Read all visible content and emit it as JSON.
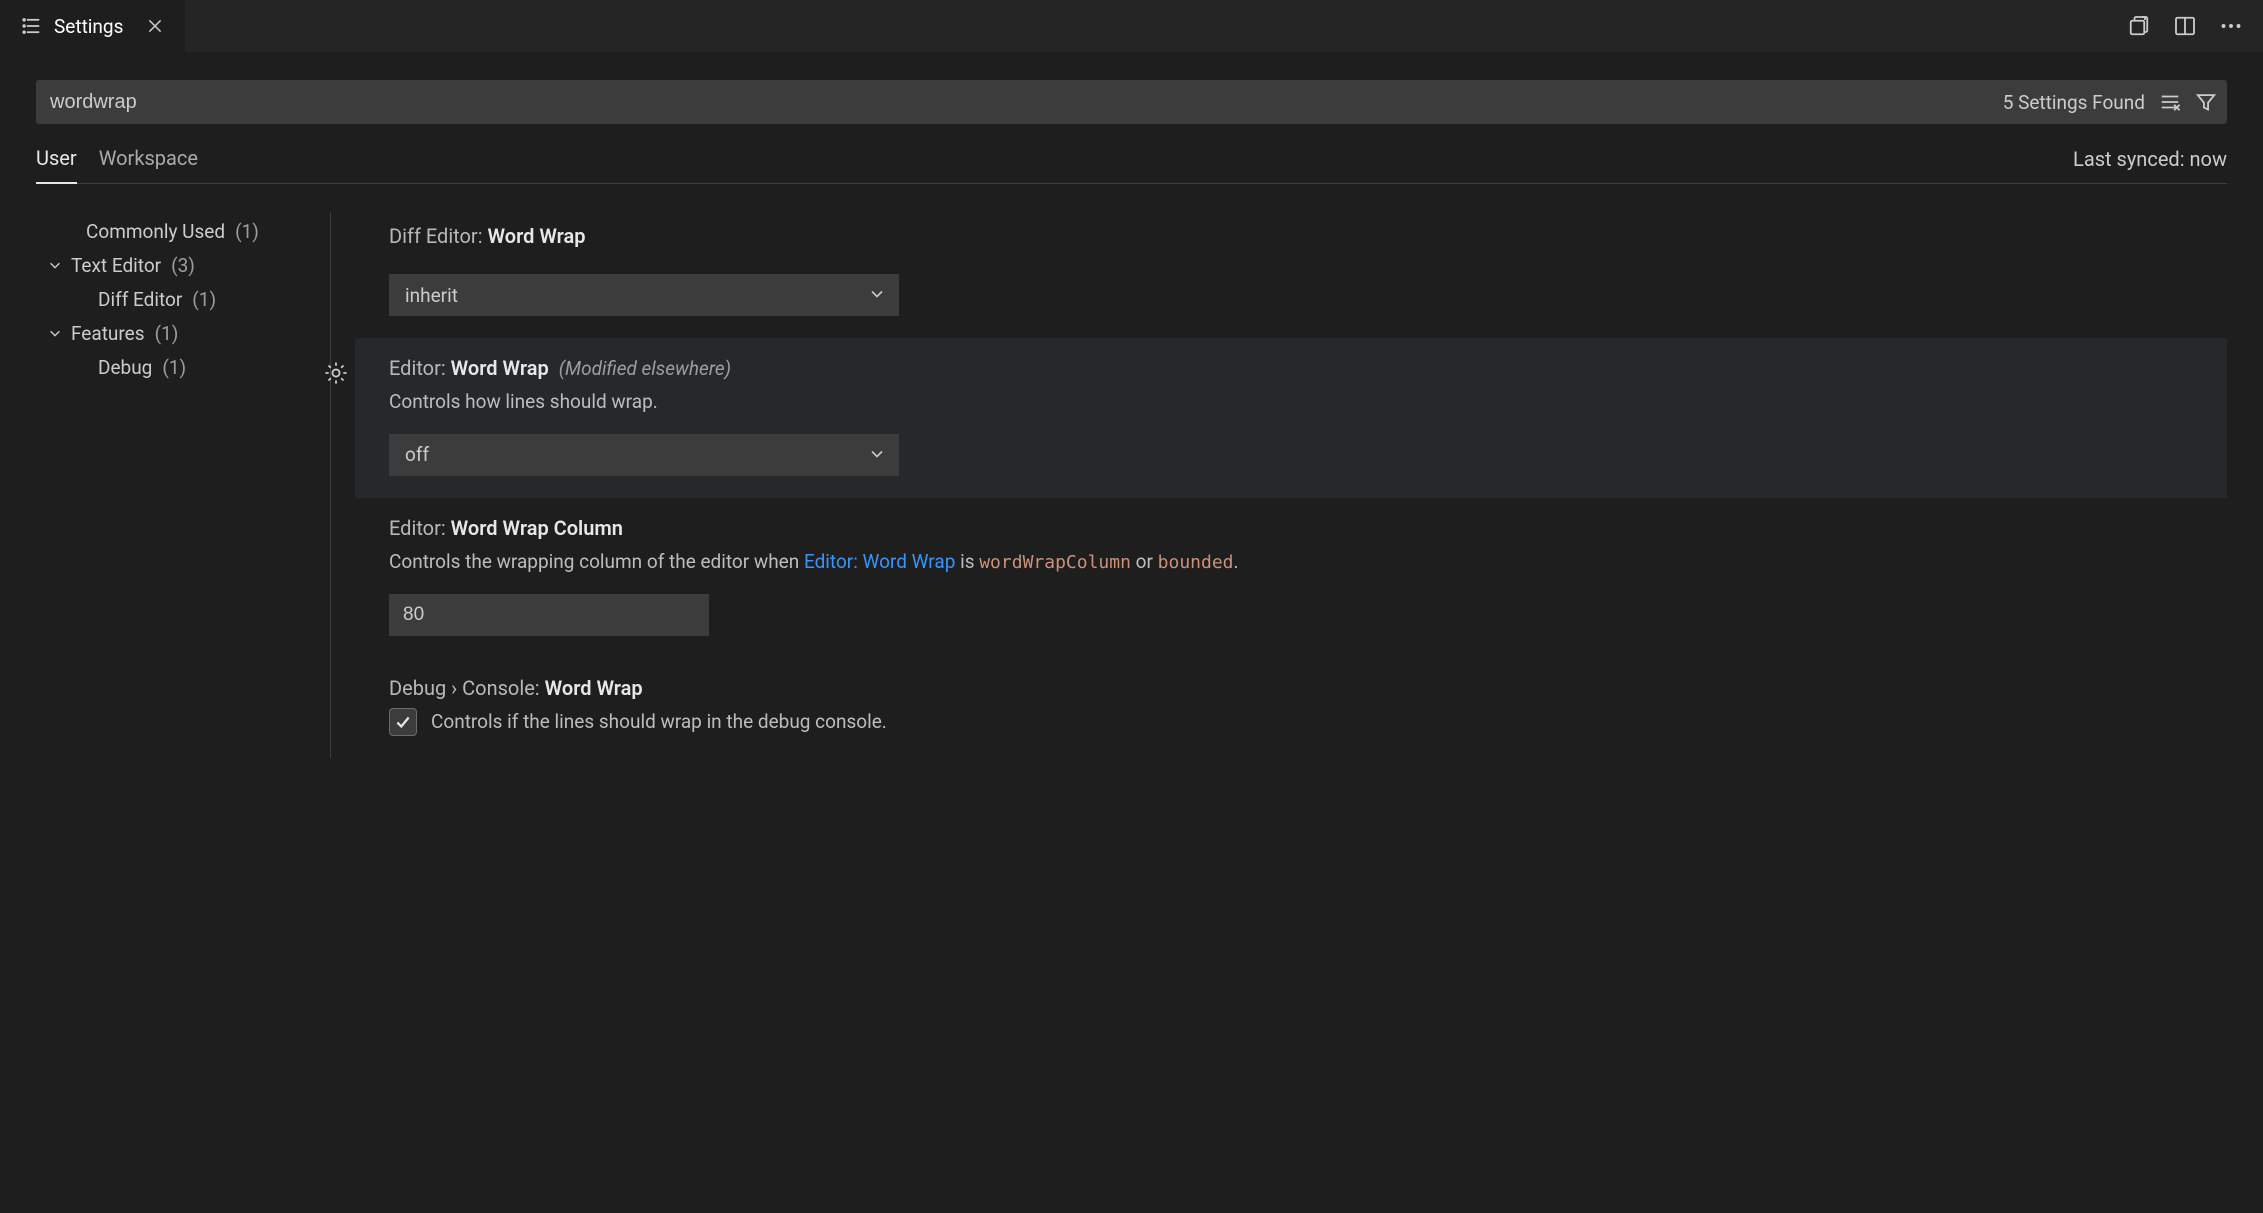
{
  "tab": {
    "title": "Settings"
  },
  "search": {
    "value": "wordwrap",
    "found_label": "5 Settings Found"
  },
  "scope": {
    "user": "User",
    "workspace": "Workspace"
  },
  "sync_status": "Last synced: now",
  "tree": {
    "commonly_used": {
      "label": "Commonly Used",
      "count": "(1)"
    },
    "text_editor": {
      "label": "Text Editor",
      "count": "(3)"
    },
    "diff_editor": {
      "label": "Diff Editor",
      "count": "(1)"
    },
    "features": {
      "label": "Features",
      "count": "(1)"
    },
    "debug": {
      "label": "Debug",
      "count": "(1)"
    }
  },
  "settings": {
    "diff_word_wrap": {
      "scope": "Diff Editor: ",
      "name": "Word Wrap",
      "value": "inherit"
    },
    "editor_word_wrap": {
      "scope": "Editor: ",
      "name": "Word Wrap",
      "hint": "(Modified elsewhere)",
      "desc": "Controls how lines should wrap.",
      "value": "off"
    },
    "editor_word_wrap_column": {
      "scope": "Editor: ",
      "name": "Word Wrap Column",
      "desc_pre": "Controls the wrapping column of the editor when ",
      "link": "Editor: Word Wrap",
      "desc_mid": " is ",
      "code1": "wordWrapColumn",
      "desc_or": " or ",
      "code2": "bounded",
      "desc_end": ".",
      "value": "80"
    },
    "debug_console_word_wrap": {
      "scope": "Debug › Console: ",
      "name": "Word Wrap",
      "desc": "Controls if the lines should wrap in the debug console."
    }
  }
}
